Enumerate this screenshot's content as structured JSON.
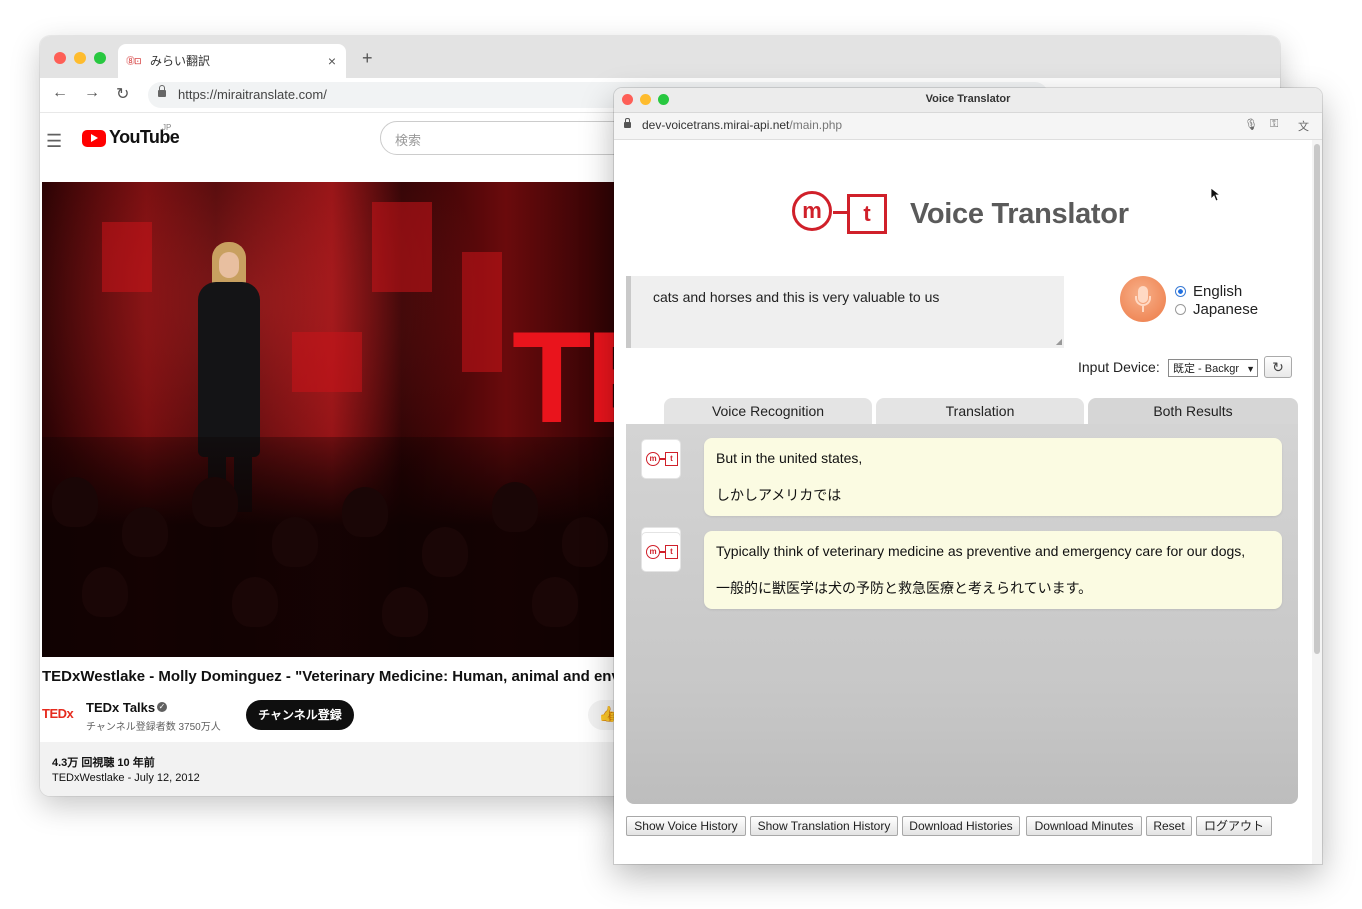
{
  "back_browser": {
    "tab_favicon": "⓼⊡",
    "tab_title": "みらい翻訳",
    "tab_close": "×",
    "new_tab": "+",
    "nav": {
      "back": "←",
      "forward": "→",
      "reload": "↻"
    },
    "url": "https://miraitranslate.com/"
  },
  "youtube": {
    "menu": "☰",
    "logo_text": "YouTube",
    "logo_region": "JP",
    "search_placeholder": "検索",
    "video_overlay_letters": "TE",
    "video_title": "TEDxWestlake - Molly Dominguez - \"Veterinary Medicine: Human, animal and environmental health\"",
    "channel_logo": "TEDx",
    "channel_name": "TEDx Talks",
    "verified": "✓",
    "subscribers": "チャンネル登録者数 3750万人",
    "subscribe": "チャンネル登録",
    "like": "👍",
    "views": "4.3万 回視聴  10 年前",
    "description_line": "TEDxWestlake - July 12, 2012"
  },
  "voice_translator": {
    "window_title": "Voice Translator",
    "url_host": "dev-voicetrans.mirai-api.net",
    "url_path": "/main.php",
    "url_icons": [
      "mic-icon",
      "key-icon",
      "translate-icon"
    ],
    "logo": {
      "m": "m",
      "t": "t"
    },
    "heading": "Voice Translator",
    "transcript": "cats and horses and this is very valuable to us",
    "languages": [
      {
        "label": "English",
        "selected": true
      },
      {
        "label": "Japanese",
        "selected": false
      }
    ],
    "input_device_label": "Input Device:",
    "input_device_value": "既定 - Backgr",
    "refresh": "↻",
    "tabs": [
      {
        "label": "Voice Recognition",
        "active": false
      },
      {
        "label": "Translation",
        "active": false
      },
      {
        "label": "Both Results",
        "active": true
      }
    ],
    "results": [
      {
        "en": "But in the united states,",
        "ja": "しかしアメリカでは"
      },
      {
        "en": "Typically think of veterinary medicine as preventive and emergency care for our dogs,",
        "ja": "一般的に獣医学は犬の予防と救急医療と考えられています。"
      }
    ],
    "buttons": [
      "Show Voice History",
      "Show Translation History",
      "Download Histories",
      "Download Minutes",
      "Reset",
      "ログアウト"
    ]
  },
  "colors": {
    "accent_red": "#d0202a",
    "bubble": "#fbfbe2",
    "youtube_red": "#ff0000"
  }
}
